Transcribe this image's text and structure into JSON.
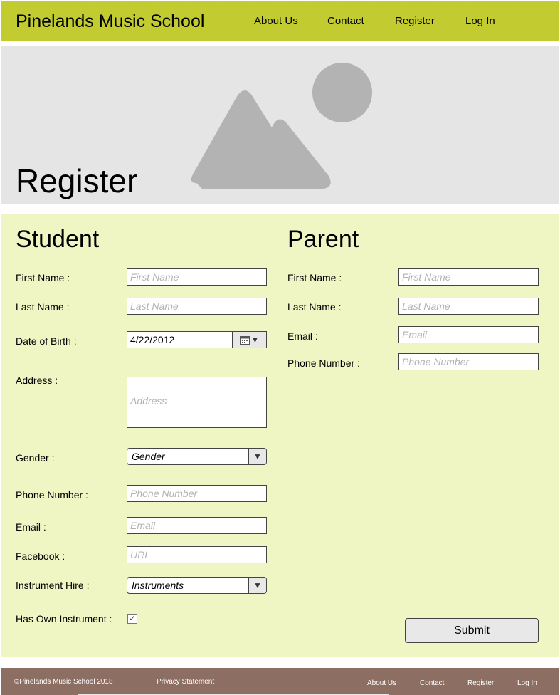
{
  "header": {
    "brand": "Pinelands Music School",
    "nav": [
      "About Us",
      "Contact",
      "Register",
      "Log In"
    ],
    "color": "#c2cb2f"
  },
  "hero": {
    "title": "Register",
    "image_icon": "image-placeholder-icon"
  },
  "student": {
    "title": "Student",
    "first_name": {
      "label": "First Name :",
      "placeholder": "First Name"
    },
    "last_name": {
      "label": "Last Name :",
      "placeholder": "Last Name"
    },
    "dob": {
      "label": "Date of Birth :",
      "value": "4/22/2012",
      "icon": "calendar-icon"
    },
    "address": {
      "label": "Address :",
      "placeholder": "Address"
    },
    "gender": {
      "label": "Gender :",
      "value": "Gender"
    },
    "phone": {
      "label": "Phone Number :",
      "placeholder": "Phone Number"
    },
    "email": {
      "label": "Email :",
      "placeholder": "Email"
    },
    "facebook": {
      "label": "Facebook :",
      "placeholder": "URL"
    },
    "instrument_hire": {
      "label": "Instrument Hire :",
      "value": "Instruments"
    },
    "own_instrument": {
      "label": "Has Own Instrument :",
      "checked": true
    }
  },
  "parent": {
    "title": "Parent",
    "first_name": {
      "label": "First Name :",
      "placeholder": "First Name"
    },
    "last_name": {
      "label": "Last Name :",
      "placeholder": "Last Name"
    },
    "email": {
      "label": "Email :",
      "placeholder": "Email"
    },
    "phone": {
      "label": "Phone Number :",
      "placeholder": "Phone Number"
    }
  },
  "submit_label": "Submit",
  "footer": {
    "copyright": "©Pinelands Music School 2018",
    "privacy": "Privacy Statement",
    "links": [
      "About Us",
      "Contact",
      "Register",
      "Log In"
    ],
    "color": "#8d6e63"
  }
}
